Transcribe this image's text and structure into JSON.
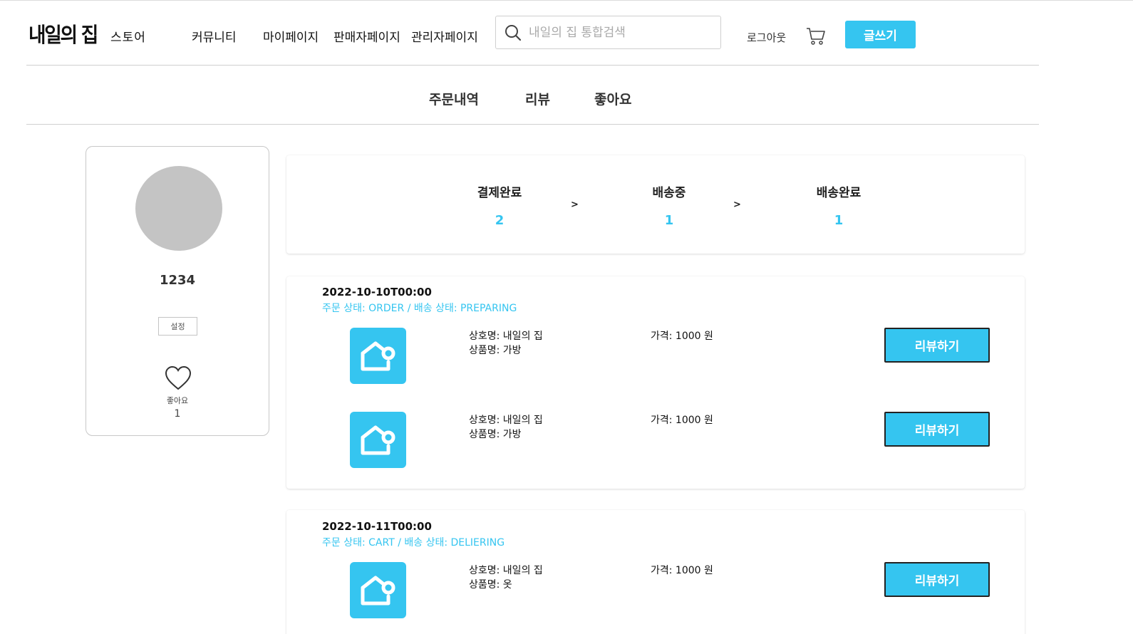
{
  "header": {
    "logo": "내일의 집",
    "store": "스토어",
    "nav": [
      "커뮤니티",
      "마이페이지",
      "판매자페이지",
      "관리자페이지"
    ],
    "search_placeholder": "내일의 집 통합검색",
    "logout": "로그아웃",
    "write_label": "글쓰기"
  },
  "subnav": [
    "주문내역",
    "리뷰",
    "좋아요"
  ],
  "profile": {
    "username": "1234",
    "settings_label": "설정",
    "likes_label": "좋아요",
    "likes_count": "1"
  },
  "status_summary": [
    {
      "label": "결제완료",
      "count": "2"
    },
    {
      "label": "배송중",
      "count": "1"
    },
    {
      "label": "배송완료",
      "count": "1"
    }
  ],
  "arrow": ">",
  "orders": [
    {
      "date": "2022-10-10T00:00",
      "status": "주문 상태: ORDER / 배송 상태: PREPARING",
      "items": [
        {
          "shop": "상호명: 내일의 집",
          "product": "상품명: 가방",
          "price": "가격: 1000 원",
          "review_label": "리뷰하기"
        },
        {
          "shop": "상호명: 내일의 집",
          "product": "상품명: 가방",
          "price": "가격: 1000 원",
          "review_label": "리뷰하기"
        }
      ]
    },
    {
      "date": "2022-10-11T00:00",
      "status": "주문 상태: CART / 배송 상태: DELIERING",
      "items": [
        {
          "shop": "상호명: 내일의 집",
          "product": "상품명: 옷",
          "price": "가격: 1000 원",
          "review_label": "리뷰하기"
        }
      ]
    }
  ],
  "colors": {
    "accent": "#35c5f0",
    "avatar": "#c4c4c4",
    "divider": "#cfcfcf"
  }
}
